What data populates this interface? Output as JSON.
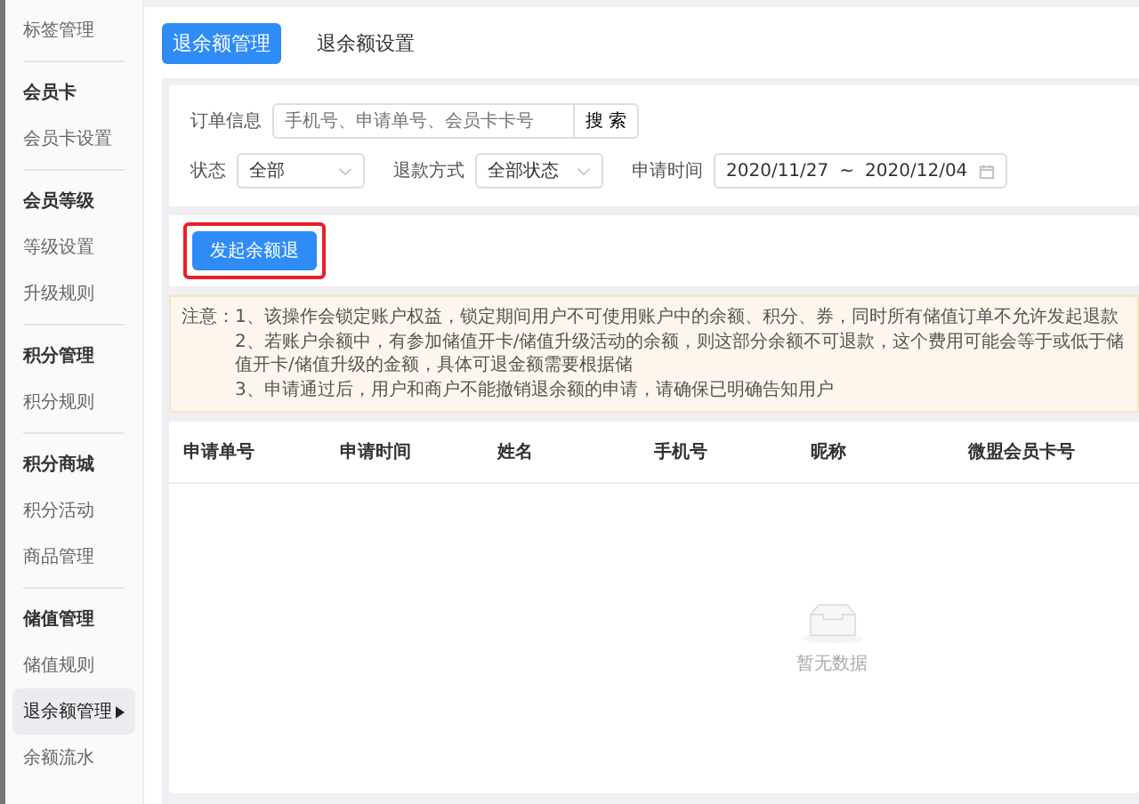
{
  "sidebar": {
    "groups": [
      {
        "items": [
          {
            "label": "标签管理",
            "selected": false
          }
        ]
      },
      {
        "title": "会员卡",
        "items": [
          {
            "label": "会员卡设置",
            "selected": false
          }
        ]
      },
      {
        "title": "会员等级",
        "items": [
          {
            "label": "等级设置",
            "selected": false
          },
          {
            "label": "升级规则",
            "selected": false
          }
        ]
      },
      {
        "title": "积分管理",
        "items": [
          {
            "label": "积分规则",
            "selected": false
          }
        ]
      },
      {
        "title": "积分商城",
        "items": [
          {
            "label": "积分活动",
            "selected": false
          },
          {
            "label": "商品管理",
            "selected": false
          }
        ]
      },
      {
        "title": "储值管理",
        "items": [
          {
            "label": "储值规则",
            "selected": false
          },
          {
            "label": "退余额管理",
            "selected": true
          },
          {
            "label": "余额流水",
            "selected": false
          }
        ]
      }
    ]
  },
  "tabs": [
    {
      "label": "退余额管理",
      "selected": true
    },
    {
      "label": "退余额设置",
      "selected": false
    }
  ],
  "filters": {
    "order_info": {
      "label": "订单信息",
      "placeholder": "手机号、申请单号、会员卡卡号",
      "button": "搜 索"
    },
    "status": {
      "label": "状态",
      "value": "全部"
    },
    "refund_method": {
      "label": "退款方式",
      "value": "全部状态"
    },
    "apply_time": {
      "label": "申请时间",
      "start": "2020/11/27",
      "separator": "~",
      "end": "2020/12/04"
    }
  },
  "action_button": {
    "label": "发起余额退",
    "highlighted": true
  },
  "notice": {
    "title": "注意：",
    "lines": [
      "1、该操作会锁定账户权益，锁定期间用户不可使用账户中的余额、积分、券，同时所有储值订单不允许发起退款",
      "2、若账户余额中，有参加储值开卡/储值升级活动的余额，则这部分余额不可退款，这个费用可能会等于或低于储值开卡/储值升级的金额，具体可退金额需要根据储",
      "3、申请通过后，用户和商户不能撤销退余额的申请，请确保已明确告知用户"
    ]
  },
  "table": {
    "columns": [
      "申请单号",
      "申请时间",
      "姓名",
      "手机号",
      "昵称",
      "微盟会员卡号"
    ],
    "empty_text": "暂无数据"
  }
}
